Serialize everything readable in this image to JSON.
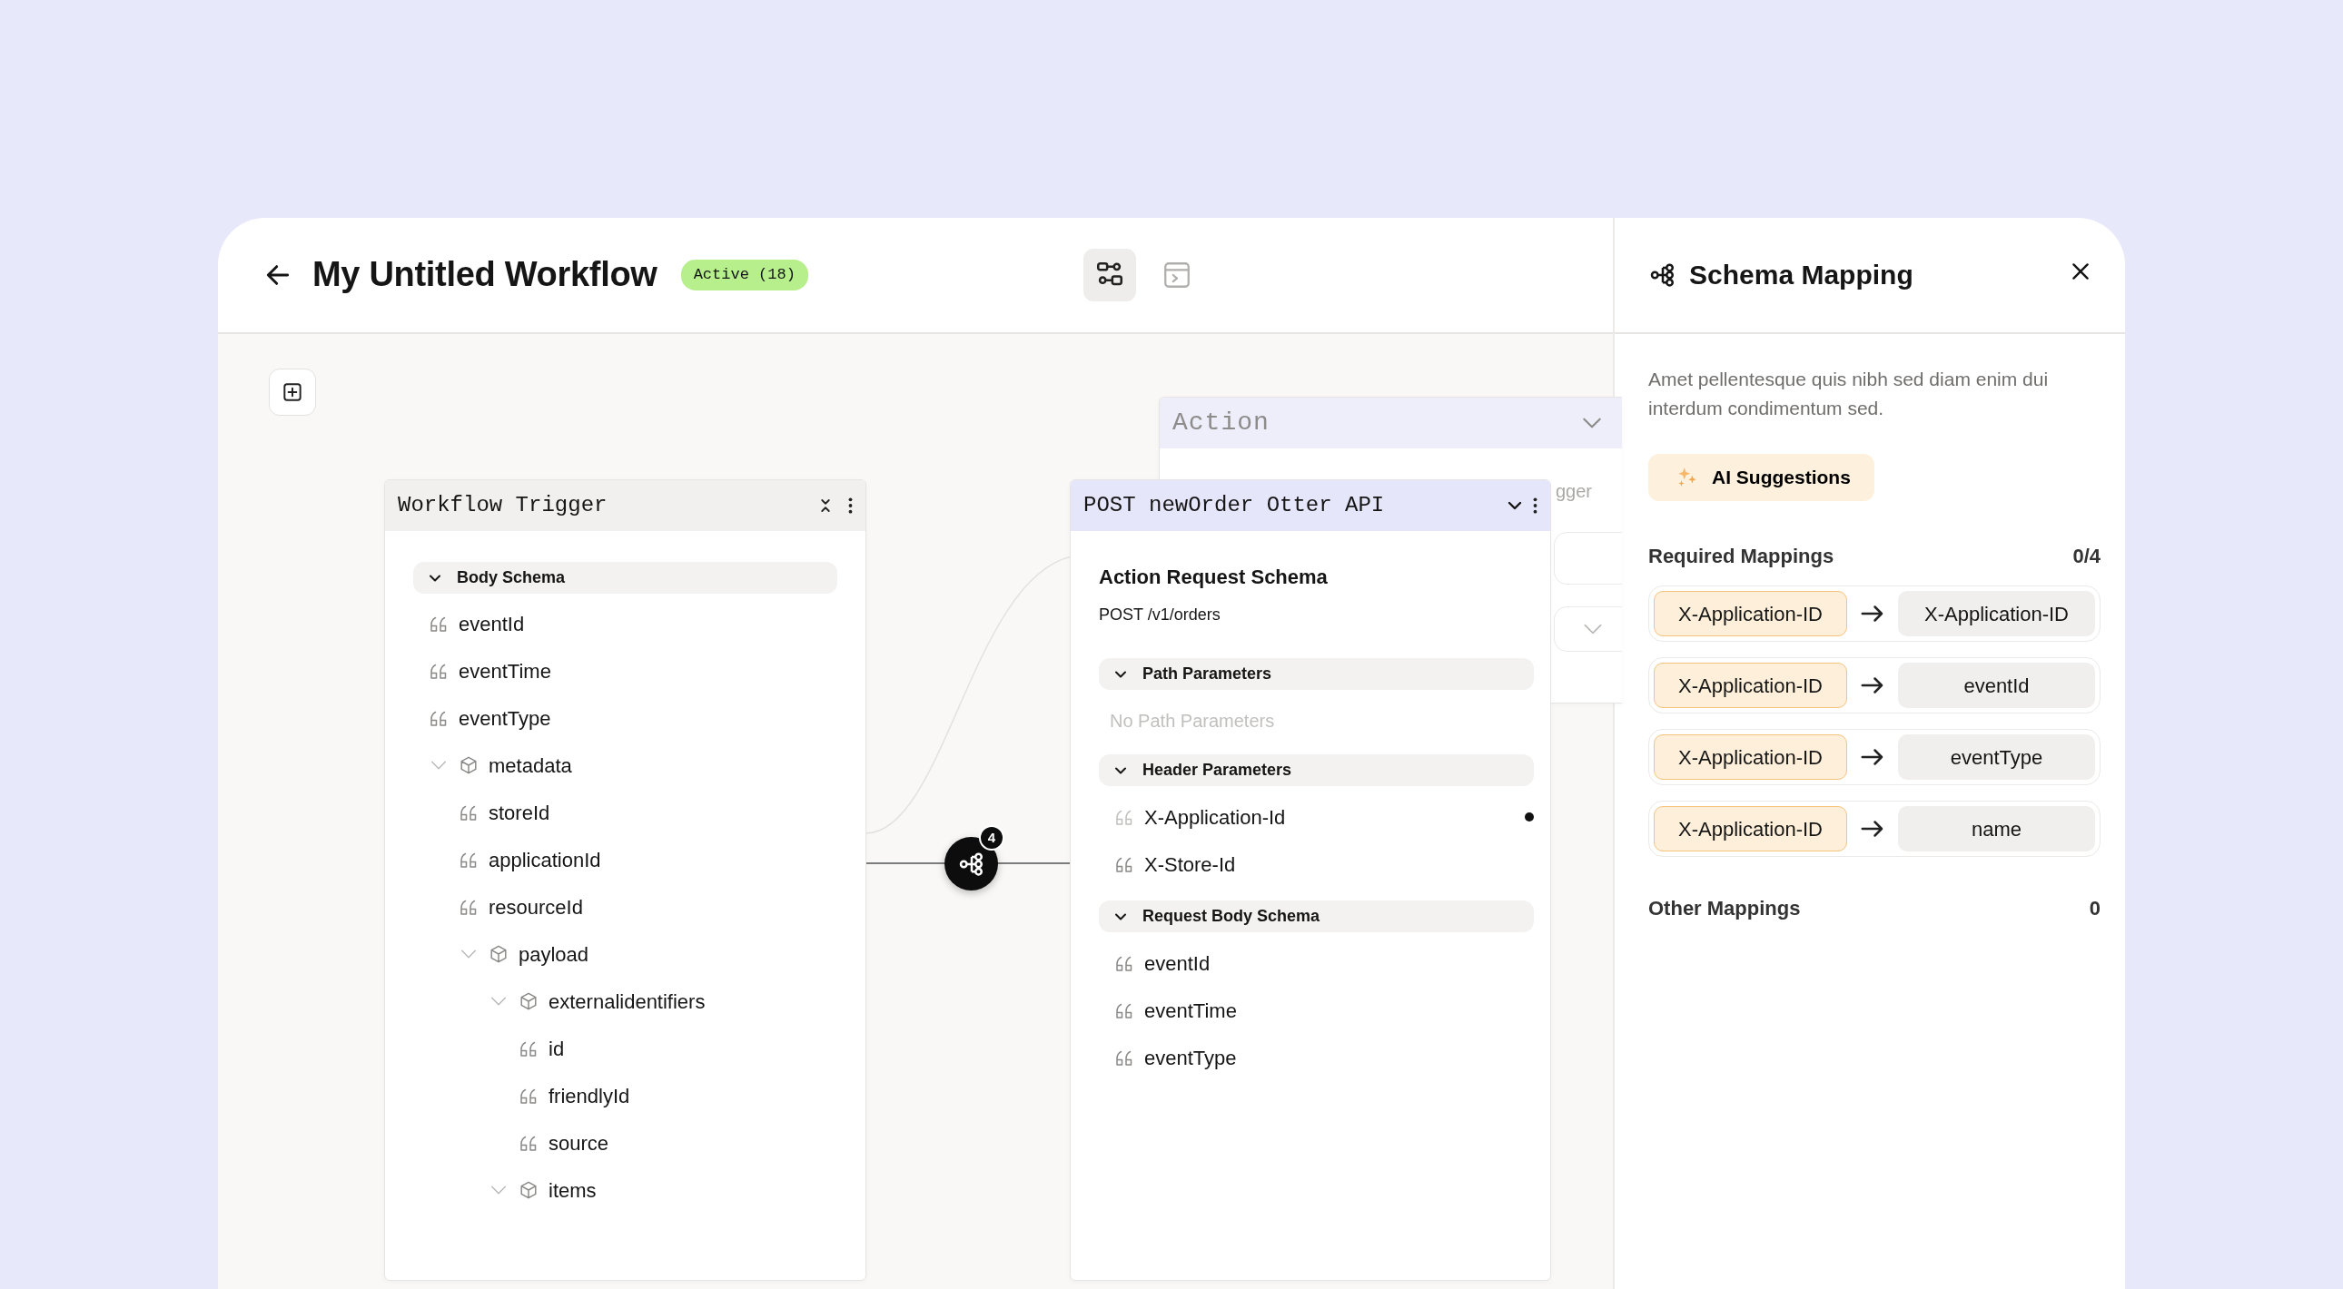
{
  "header": {
    "title": "My Untitled Workflow",
    "status_badge": "Active (18)"
  },
  "view_buttons": [
    {
      "kind": "flow",
      "selected": true
    },
    {
      "kind": "terminal",
      "selected": false
    }
  ],
  "action_card": {
    "title": "Action",
    "partial_text": "gger"
  },
  "trigger_card": {
    "title": "Workflow Trigger",
    "section": {
      "label": "Body Schema",
      "expanded": true
    },
    "fields": [
      {
        "kind": "string",
        "name": "eventId"
      },
      {
        "kind": "string",
        "name": "eventTime"
      },
      {
        "kind": "string",
        "name": "eventType"
      },
      {
        "kind": "object",
        "name": "metadata",
        "expanded": true,
        "children": [
          {
            "kind": "string",
            "name": "storeId"
          },
          {
            "kind": "string",
            "name": "applicationId"
          },
          {
            "kind": "string",
            "name": "resourceId"
          },
          {
            "kind": "object",
            "name": "payload",
            "expanded": true,
            "children": [
              {
                "kind": "object",
                "name": "externalidentifiers",
                "expanded": true,
                "children": [
                  {
                    "kind": "string",
                    "name": "id"
                  },
                  {
                    "kind": "string",
                    "name": "friendlyId"
                  },
                  {
                    "kind": "string",
                    "name": "source"
                  }
                ]
              },
              {
                "kind": "object",
                "name": "items",
                "expanded": true
              }
            ]
          }
        ]
      }
    ]
  },
  "connector": {
    "badge": "4"
  },
  "action_node": {
    "title": "POST newOrder Otter API",
    "heading": "Action Request Schema",
    "endpoint": "POST /v1/orders",
    "sections": [
      {
        "label": "Path Parameters",
        "expanded": true,
        "empty_text": "No Path Parameters"
      },
      {
        "label": "Header Parameters",
        "expanded": true,
        "fields": [
          {
            "name": "X-Application-Id",
            "flagged": true
          },
          {
            "name": "X-Store-Id",
            "flagged": false
          }
        ]
      },
      {
        "label": "Request Body Schema",
        "expanded": true,
        "fields": [
          {
            "name": "eventId"
          },
          {
            "name": "eventTime"
          },
          {
            "name": "eventType"
          }
        ]
      }
    ]
  },
  "schema_panel": {
    "title": "Schema Mapping",
    "description": "Amet pellentesque quis nibh sed diam enim dui interdum condimentum sed.",
    "ai_button": "AI Suggestions",
    "required": {
      "label": "Required Mappings",
      "count": "0/4",
      "mappings": [
        {
          "source": "X-Application-ID",
          "target": "X-Application-ID"
        },
        {
          "source": "X-Application-ID",
          "target": "eventId"
        },
        {
          "source": "X-Application-ID",
          "target": "eventType"
        },
        {
          "source": "X-Application-ID",
          "target": "name"
        }
      ]
    },
    "other": {
      "label": "Other Mappings",
      "count": "0"
    }
  }
}
